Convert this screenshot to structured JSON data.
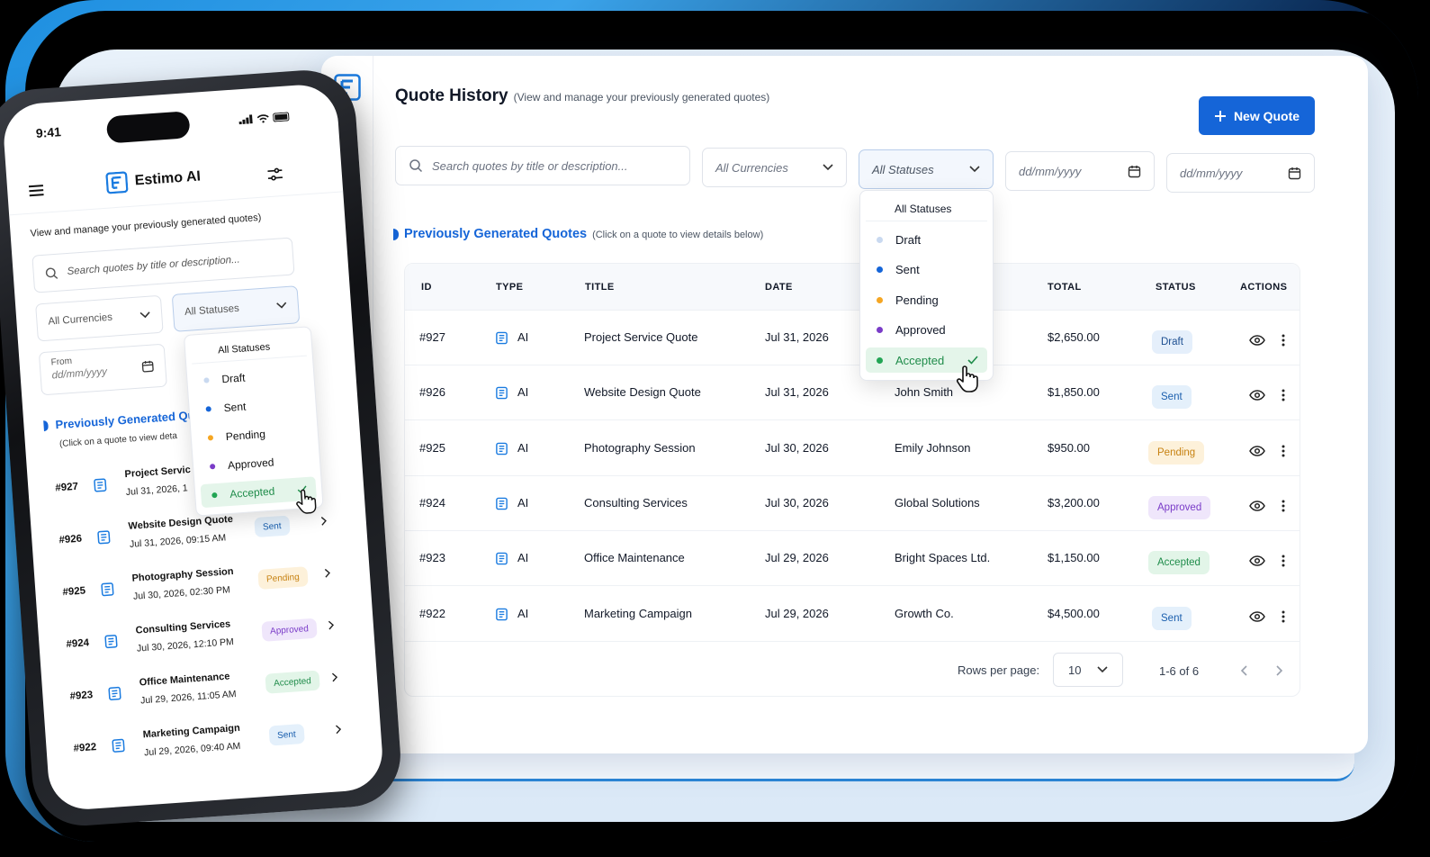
{
  "desktop": {
    "title": "Quote History",
    "subtitle": "(View and manage your previously generated quotes)",
    "new_quote_label": "New Quote",
    "search_placeholder": "Search quotes by title or description...",
    "currency_filter": "All Currencies",
    "status_filter": "All Statuses",
    "date_from_placeholder": "dd/mm/yyyy",
    "date_to_placeholder": "dd/mm/yyyy",
    "section_title": "Previously Generated Quotes",
    "section_hint": "(Click on a quote to view details below)",
    "columns": [
      "ID",
      "TYPE",
      "TITLE",
      "DATE",
      "TOTAL",
      "STATUS",
      "ACTIONS"
    ],
    "rows": [
      {
        "id": "#927",
        "type": "AI",
        "title": "Project Service Quote",
        "date": "Jul 31, 2026",
        "client": "",
        "total": "$2,650.00",
        "status": "Draft"
      },
      {
        "id": "#926",
        "type": "AI",
        "title": "Website Design Quote",
        "date": "Jul 31, 2026",
        "client": "John Smith",
        "total": "$1,850.00",
        "status": "Sent"
      },
      {
        "id": "#925",
        "type": "AI",
        "title": "Photography Session",
        "date": "Jul 30, 2026",
        "client": "Emily Johnson",
        "total": "$950.00",
        "status": "Pending"
      },
      {
        "id": "#924",
        "type": "AI",
        "title": "Consulting Services",
        "date": "Jul 30, 2026",
        "client": "Global Solutions",
        "total": "$3,200.00",
        "status": "Approved"
      },
      {
        "id": "#923",
        "type": "AI",
        "title": "Office Maintenance",
        "date": "Jul 29, 2026",
        "client": "Bright Spaces Ltd.",
        "total": "$1,150.00",
        "status": "Accepted"
      },
      {
        "id": "#922",
        "type": "AI",
        "title": "Marketing Campaign",
        "date": "Jul 29, 2026",
        "client": "Growth Co.",
        "total": "$4,500.00",
        "status": "Sent"
      }
    ],
    "rows_per_page_label": "Rows per page:",
    "rows_per_page_value": "10",
    "range_label": "1-6 of 6",
    "status_dropdown": {
      "header": "All Statuses",
      "options": [
        {
          "label": "Draft",
          "color": "#c9d9f0"
        },
        {
          "label": "Sent",
          "color": "#1565d8"
        },
        {
          "label": "Pending",
          "color": "#f5a623"
        },
        {
          "label": "Approved",
          "color": "#7a3cc8"
        },
        {
          "label": "Accepted",
          "color": "#22a554"
        }
      ],
      "selected": "Accepted"
    }
  },
  "phone": {
    "time": "9:41",
    "brand": "Estimo AI",
    "subtitle": "View and manage your previously generated quotes)",
    "search_placeholder": "Search quotes by title or description...",
    "currency_filter": "All Currencies",
    "status_filter": "All Statuses",
    "from_label": "From",
    "date_placeholder": "dd/mm/yyyy",
    "section_title": "Previously Generated Qu",
    "section_hint": "(Click on a quote to view deta",
    "rows": [
      {
        "id": "#927",
        "title": "Project Servic",
        "date": "Jul 31, 2026, 1",
        "status": ""
      },
      {
        "id": "#926",
        "title": "Website Design Quote",
        "date": "Jul 31, 2026, 09:15 AM",
        "status": "Sent"
      },
      {
        "id": "#925",
        "title": "Photography Session",
        "date": "Jul 30, 2026, 02:30 PM",
        "status": "Pending"
      },
      {
        "id": "#924",
        "title": "Consulting Services",
        "date": "Jul 30, 2026, 12:10 PM",
        "status": "Approved"
      },
      {
        "id": "#923",
        "title": "Office Maintenance",
        "date": "Jul 29, 2026, 11:05 AM",
        "status": "Accepted"
      },
      {
        "id": "#922",
        "title": "Marketing Campaign",
        "date": "Jul 29, 2026, 09:40 AM",
        "status": "Sent"
      }
    ],
    "status_dropdown": {
      "header": "All Statuses",
      "options": [
        "Draft",
        "Sent",
        "Pending",
        "Approved",
        "Accepted"
      ],
      "selected": "Accepted"
    }
  },
  "colors": {
    "accent": "#1565d8",
    "draft": "#e5effb",
    "sent": "#e4f0fb",
    "pending": "#fdf1da",
    "approved": "#efe6fb",
    "accepted": "#e2f5e8"
  },
  "icons": [
    "logo-icon",
    "document-icon",
    "user-icon",
    "gear-icon",
    "help-icon",
    "search-icon",
    "chevron-down-icon",
    "calendar-icon",
    "plus-icon",
    "eye-icon",
    "more-vertical-icon",
    "check-icon",
    "chevron-left-icon",
    "chevron-right-icon",
    "menu-icon",
    "filter-icon",
    "pointer-hand-icon"
  ]
}
